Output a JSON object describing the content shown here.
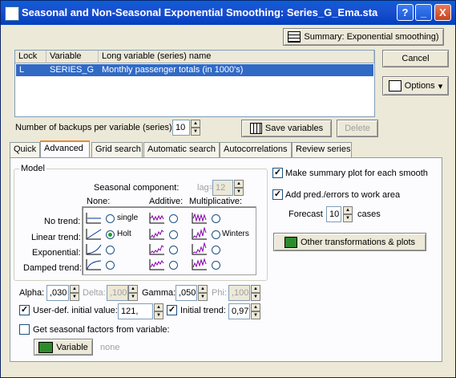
{
  "window": {
    "title": "Seasonal and Non-Seasonal Exponential Smoothing: Series_G_Ema.sta",
    "help": "?",
    "minimize": "_",
    "close": "X"
  },
  "summary_button": "Summary:  Exponential smoothing)",
  "cancel_button": "Cancel",
  "options_button": "Options",
  "variable_list": {
    "headers": [
      "Lock",
      "Variable",
      "Long variable (series) name"
    ],
    "rows": [
      {
        "lock": "L",
        "variable": "SERIES_G",
        "long_name": "Monthly passenger totals (in 1000's)"
      }
    ]
  },
  "backups": {
    "label": "Number of backups per variable (series):",
    "value": "10"
  },
  "save_variables_button": "Save variables",
  "delete_button": "Delete",
  "tabs": [
    "Quick",
    "Advanced",
    "Grid search",
    "Automatic search",
    "Autocorrelations",
    "Review series"
  ],
  "active_tab": "Advanced",
  "model": {
    "group_label": "Model",
    "seasonal_component_label": "Seasonal component:",
    "lag_label": "lag=",
    "lag_value": "12",
    "column_headers": [
      "None:",
      "Additive:",
      "Multiplicative:"
    ],
    "row_labels": [
      "No trend:",
      "Linear trend:",
      "Exponential:",
      "Damped trend:"
    ],
    "option_labels": {
      "single": "single",
      "holt": "Holt",
      "winters": "Winters"
    },
    "selected": "Holt"
  },
  "params": {
    "alpha_label": "Alpha:",
    "alpha_value": ",030",
    "delta_label": "Delta:",
    "delta_value": ",100",
    "gamma_label": "Gamma:",
    "gamma_value": ",050",
    "phi_label": "Phi:",
    "phi_value": ",100"
  },
  "user_def": {
    "label": "User-def. initial value:",
    "value": "121,",
    "checked": true
  },
  "initial_trend": {
    "label": "Initial trend:",
    "value": "0,97",
    "checked": true
  },
  "seasonal_factors": {
    "label": "Get seasonal factors from variable:",
    "checked": false
  },
  "variable_button": "Variable",
  "variable_value": "none",
  "right": {
    "summary_plot": {
      "label": "Make summary plot for each smooth",
      "checked": true
    },
    "add_pred": {
      "label": "Add pred./errors to work area",
      "checked": true
    },
    "forecast_label": "Forecast",
    "forecast_value": "10",
    "forecast_unit": "cases",
    "other_button": "Other transformations & plots"
  },
  "colors": {
    "title_bar": "#0a246a",
    "selection": "#316ac5",
    "active_tab_accent": "#e68b2c",
    "plot_line": "#8800aa"
  }
}
